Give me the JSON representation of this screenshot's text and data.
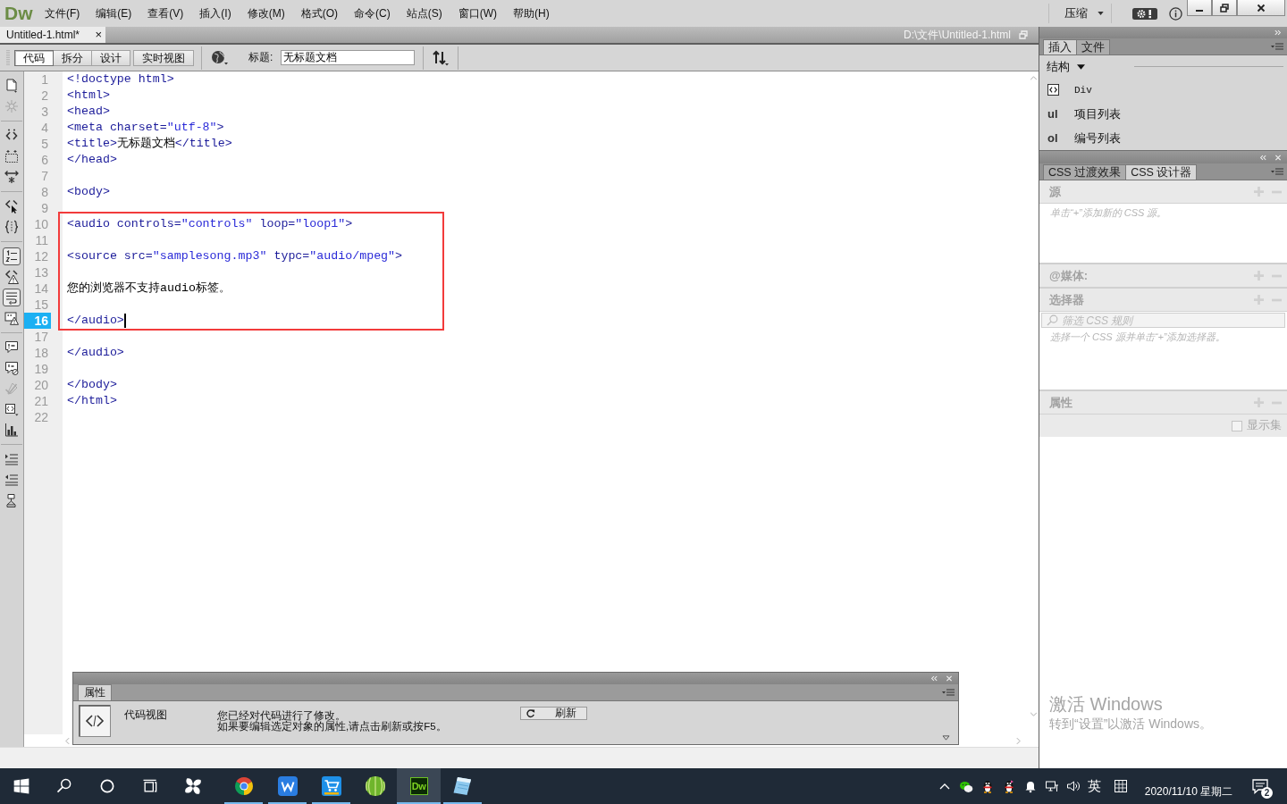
{
  "app": {
    "logo": "Dw",
    "menu": [
      "文件(F)",
      "编辑(E)",
      "查看(V)",
      "插入(I)",
      "修改(M)",
      "格式(O)",
      "命令(C)",
      "站点(S)",
      "窗口(W)",
      "帮助(H)"
    ],
    "workspace": "压缩"
  },
  "document": {
    "tab": "Untitled-1.html*",
    "close": "×",
    "path": "D:\\文件\\Untitled-1.html"
  },
  "view_bar": {
    "views": [
      {
        "label": "代码",
        "selected": true
      },
      {
        "label": "拆分",
        "selected": false
      },
      {
        "label": "设计",
        "selected": false
      },
      {
        "label": "实时视图",
        "selected": false
      }
    ],
    "title_label": "标题:",
    "title_value": "无标题文档"
  },
  "coding_toolbar": [
    {
      "tools": [
        {
          "kind": "document",
          "on": false,
          "disabled": false
        },
        {
          "kind": "asterisk",
          "on": false,
          "disabled": true
        }
      ]
    },
    {
      "tools": [
        {
          "kind": "collapse-tag",
          "on": false,
          "disabled": false
        },
        {
          "kind": "collapse-selection",
          "on": false,
          "disabled": false
        },
        {
          "kind": "expand-all",
          "on": false,
          "disabled": false
        }
      ]
    },
    {
      "tools": [
        {
          "kind": "select-parent",
          "on": false,
          "disabled": false
        },
        {
          "kind": "balance-braces",
          "on": false,
          "disabled": false
        }
      ]
    },
    {
      "tools": [
        {
          "kind": "line-numbers",
          "on": true,
          "disabled": false
        },
        {
          "kind": "invalid-code",
          "on": false,
          "disabled": false
        },
        {
          "kind": "word-wrap",
          "on": true,
          "disabled": false
        },
        {
          "kind": "syntax-alerts",
          "on": false,
          "disabled": false
        }
      ]
    },
    {
      "tools": [
        {
          "kind": "apply-comment",
          "on": false,
          "disabled": false
        },
        {
          "kind": "remove-comment",
          "on": false,
          "disabled": false
        },
        {
          "kind": "wrap-tag",
          "on": false,
          "disabled": true
        },
        {
          "kind": "recent-snippets",
          "on": false,
          "disabled": false
        },
        {
          "kind": "move-css",
          "on": false,
          "disabled": false
        }
      ]
    },
    {
      "tools": [
        {
          "kind": "indent",
          "on": false,
          "disabled": false
        },
        {
          "kind": "outdent",
          "on": false,
          "disabled": false
        },
        {
          "kind": "format",
          "on": false,
          "disabled": false
        }
      ]
    }
  ],
  "code": {
    "blocks": [
      {
        "boxed": false,
        "lines": [
          {
            "number": "1",
            "selected": false,
            "tokens": [
              {
                "kind": "tag",
                "text": "<!doctype html>"
              }
            ]
          },
          {
            "number": "2",
            "selected": false,
            "tokens": [
              {
                "kind": "tag",
                "text": "<html>"
              }
            ]
          },
          {
            "number": "3",
            "selected": false,
            "tokens": [
              {
                "kind": "tag",
                "text": "<head>"
              }
            ]
          },
          {
            "number": "4",
            "selected": false,
            "tokens": [
              {
                "kind": "tag",
                "text": "<meta charset="
              },
              {
                "kind": "value",
                "text": "\"utf-8\""
              },
              {
                "kind": "tag",
                "text": ">"
              }
            ]
          },
          {
            "number": "5",
            "selected": false,
            "tokens": [
              {
                "kind": "tag",
                "text": "<title>"
              },
              {
                "kind": "text",
                "text": "无标题文档"
              },
              {
                "kind": "tag",
                "text": "</title>"
              }
            ]
          },
          {
            "number": "6",
            "selected": false,
            "tokens": [
              {
                "kind": "tag",
                "text": "</head>"
              }
            ]
          },
          {
            "number": "7",
            "selected": false
          },
          {
            "number": "8",
            "selected": false,
            "tokens": [
              {
                "kind": "tag",
                "text": "<body>"
              }
            ]
          },
          {
            "number": "9",
            "selected": false
          }
        ]
      },
      {
        "boxed": true,
        "lines": [
          {
            "number": "10",
            "selected": false,
            "tokens": [
              {
                "kind": "tag",
                "text": "<audio controls="
              },
              {
                "kind": "value",
                "text": "\"controls\""
              },
              {
                "kind": "tag",
                "text": " loop="
              },
              {
                "kind": "value",
                "text": "\"loop1\""
              },
              {
                "kind": "tag",
                "text": ">"
              }
            ]
          },
          {
            "number": "11",
            "selected": false
          },
          {
            "number": "12",
            "selected": false,
            "tokens": [
              {
                "kind": "tag",
                "text": "<source src="
              },
              {
                "kind": "value",
                "text": "\"samplesong.mp3\""
              },
              {
                "kind": "tag",
                "text": " typc="
              },
              {
                "kind": "value",
                "text": "\"audio/mpeg\""
              },
              {
                "kind": "tag",
                "text": ">"
              }
            ]
          },
          {
            "number": "13",
            "selected": false
          },
          {
            "number": "14",
            "selected": false,
            "tokens": [
              {
                "kind": "text",
                "text": "您的浏览器不支持audio标签。"
              }
            ]
          },
          {
            "number": "15",
            "selected": false
          },
          {
            "number": "16",
            "selected": true,
            "tokens": [
              {
                "kind": "tag",
                "text": "</audio>"
              }
            ]
          }
        ]
      },
      {
        "boxed": false,
        "lines": [
          {
            "number": "17",
            "selected": false
          },
          {
            "number": "18",
            "selected": false,
            "tokens": [
              {
                "kind": "tag",
                "text": "</audio>"
              }
            ]
          },
          {
            "number": "19",
            "selected": false
          },
          {
            "number": "20",
            "selected": false,
            "tokens": [
              {
                "kind": "tag",
                "text": "</body>"
              }
            ]
          },
          {
            "number": "21",
            "selected": false,
            "tokens": [
              {
                "kind": "tag",
                "text": "</html>"
              }
            ]
          },
          {
            "number": "22",
            "selected": false
          }
        ]
      }
    ]
  },
  "properties": {
    "tab": "属性",
    "view": "代码视图",
    "message": [
      "您已经对代码进行了修改。",
      "如果要编辑选定对象的属性,请点击刷新或按F5。"
    ],
    "refresh": "刷新"
  },
  "insert_panel": {
    "tabs": [
      {
        "label": "插入",
        "selected": true
      },
      {
        "label": "文件",
        "selected": false
      }
    ],
    "category": "结构",
    "items": [
      {
        "kind": "icon",
        "label": "Div"
      },
      {
        "kind": "glyph",
        "glyph": "ul",
        "label": "项目列表"
      },
      {
        "kind": "glyph",
        "glyph": "ol",
        "label": "编号列表"
      }
    ]
  },
  "css_designer": {
    "tabs": [
      {
        "label": "CSS 过渡效果",
        "selected": false
      },
      {
        "label": "CSS 设计器",
        "selected": true
      }
    ],
    "sections": [
      {
        "kind": "list",
        "title": "源",
        "hint": "单击“+”添加新的 CSS 源。"
      },
      {
        "kind": "header",
        "title": "@媒体:"
      },
      {
        "kind": "filter-list",
        "title": "选择器",
        "filter_placeholder": "筛选 CSS 规则",
        "hint": "选择一个 CSS 源并单击“+”添加选择器。"
      },
      {
        "kind": "properties",
        "title": "属性",
        "checkbox_label": "显示集",
        "checked": false
      }
    ]
  },
  "activation_notice": {
    "title": "激活 Windows",
    "text": "转到“设置”以激活 Windows。"
  },
  "taskbar": {
    "apps": [
      {
        "kind": "start",
        "running": false,
        "selected": false
      },
      {
        "kind": "search",
        "running": false,
        "selected": false
      },
      {
        "kind": "cortana",
        "running": false,
        "selected": false
      },
      {
        "kind": "task-view",
        "running": false,
        "selected": false
      },
      {
        "kind": "pinwheel",
        "running": false,
        "selected": false
      },
      {
        "kind": "browser",
        "running": true,
        "selected": false
      },
      {
        "kind": "w-tile",
        "running": true,
        "selected": false
      },
      {
        "kind": "cart",
        "running": true,
        "selected": false
      },
      {
        "kind": "ball",
        "running": false,
        "selected": false
      },
      {
        "kind": "dreamweaver",
        "label": "Dw",
        "running": true,
        "selected": true
      },
      {
        "kind": "notepad",
        "running": true,
        "selected": false
      }
    ],
    "language": "英",
    "date": "2020/11/10 星期二",
    "notifications": "2"
  }
}
